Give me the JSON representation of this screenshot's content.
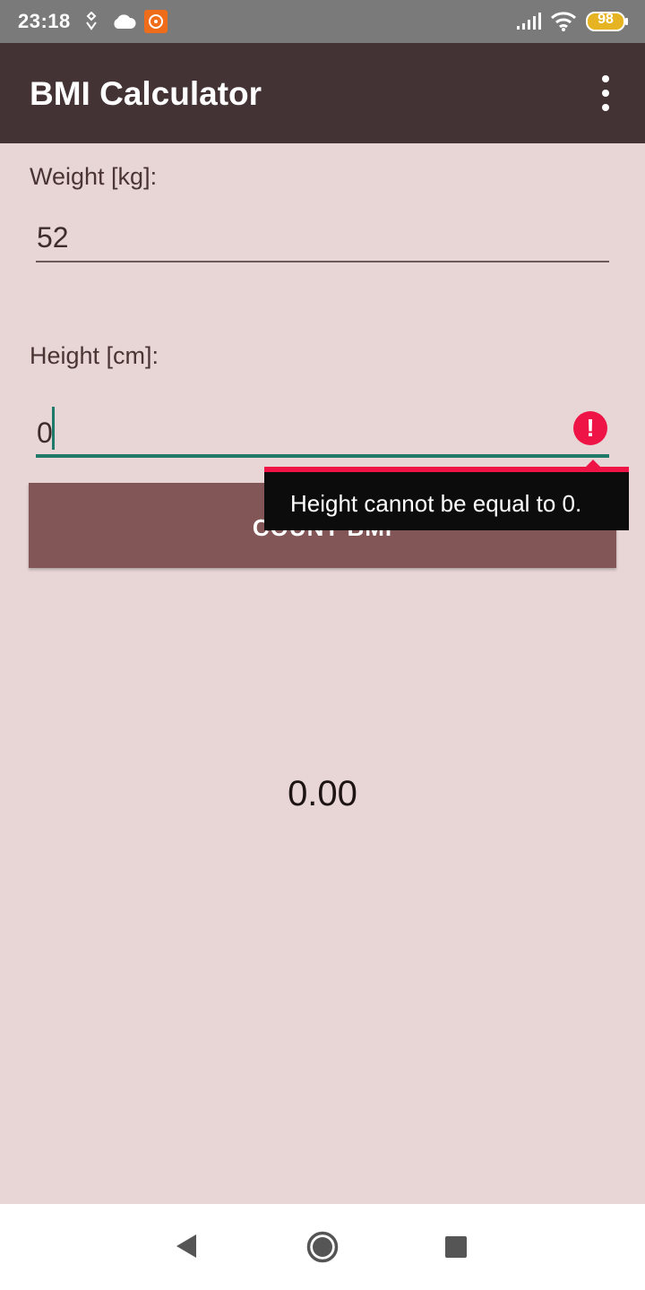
{
  "status_bar": {
    "time": "23:18",
    "battery": "98",
    "icons": [
      "location-icon",
      "cloud-icon",
      "app-notification-icon",
      "signal-icon",
      "wifi-icon",
      "battery-icon"
    ]
  },
  "app_bar": {
    "title": "BMI Calculator",
    "menu_icon": "overflow-menu-icon"
  },
  "form": {
    "weight_label": "Weight [kg]:",
    "weight_value": "52",
    "height_label": "Height [cm]:",
    "height_value": "0",
    "error_message": "Height cannot be equal to 0.",
    "count_button_label": "COUNT BMI"
  },
  "result": {
    "value": "0.00"
  },
  "nav_bar": {
    "icons": [
      "back-icon",
      "home-icon",
      "recents-icon"
    ]
  },
  "colors": {
    "app_bar": "#443334",
    "background": "#e8d6d6",
    "button": "#825657",
    "accent": "#1f7a6a",
    "error": "#ef1446"
  }
}
